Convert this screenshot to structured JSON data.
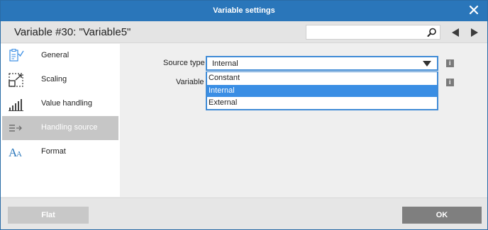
{
  "window": {
    "title": "Variable settings"
  },
  "header": {
    "variable_name": "Variable #30: \"Variable5\""
  },
  "search": {
    "placeholder": ""
  },
  "sidebar": {
    "items": [
      {
        "label": "General",
        "icon": "clipboard-check-icon"
      },
      {
        "label": "Scaling",
        "icon": "scaling-icon"
      },
      {
        "label": "Value handling",
        "icon": "bar-chart-icon"
      },
      {
        "label": "Handling source",
        "icon": "list-arrow-icon",
        "active": true
      },
      {
        "label": "Format",
        "icon": "font-format-icon"
      }
    ]
  },
  "form": {
    "source_type_label": "Source type",
    "source_type_value": "Internal",
    "variable_label": "Variable",
    "options": [
      "Constant",
      "Internal",
      "External"
    ],
    "selected_option": "Internal"
  },
  "footer": {
    "flat_label": "Flat",
    "ok_label": "OK"
  },
  "colors": {
    "titlebar": "#2a76ba",
    "accent": "#3a8ee4",
    "active_item": "#c6c6c6",
    "ok_button": "#7f7f7f"
  }
}
